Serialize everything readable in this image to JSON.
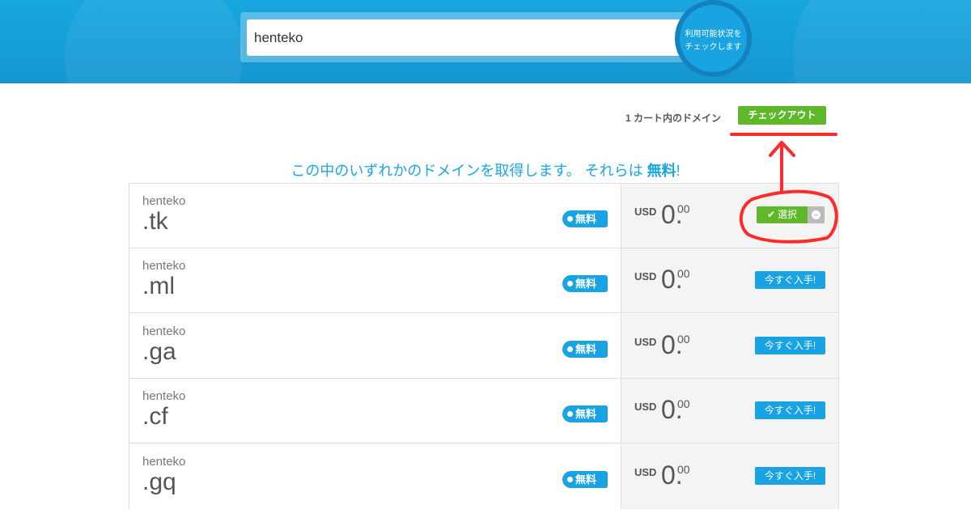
{
  "search": {
    "value": "henteko",
    "button_label": "利用可能状況をチェックします"
  },
  "cart": {
    "text": "1 カート内のドメイン",
    "checkout_label": "チェックアウト"
  },
  "heading": {
    "prefix": "この中のいずれかのドメインを取得します。 それらは ",
    "highlight": "無料",
    "suffix": "!"
  },
  "domains": [
    {
      "name": "henteko",
      "tld": ".tk",
      "badge": "無料",
      "currency": "USD",
      "price_int": "0.",
      "price_dec": "00",
      "action": "選択",
      "selected": true
    },
    {
      "name": "henteko",
      "tld": ".ml",
      "badge": "無料",
      "currency": "USD",
      "price_int": "0.",
      "price_dec": "00",
      "action": "今すぐ入手!",
      "selected": false
    },
    {
      "name": "henteko",
      "tld": ".ga",
      "badge": "無料",
      "currency": "USD",
      "price_int": "0.",
      "price_dec": "00",
      "action": "今すぐ入手!",
      "selected": false
    },
    {
      "name": "henteko",
      "tld": ".cf",
      "badge": "無料",
      "currency": "USD",
      "price_int": "0.",
      "price_dec": "00",
      "action": "今すぐ入手!",
      "selected": false
    },
    {
      "name": "henteko",
      "tld": ".gq",
      "badge": "無料",
      "currency": "USD",
      "price_int": "0.",
      "price_dec": "00",
      "action": "今すぐ入手!",
      "selected": false
    }
  ],
  "icons": {
    "select_check": "check-icon",
    "remove": "minus-circle-icon",
    "badge_dot": "dot-icon"
  },
  "colors": {
    "brand_blue": "#1aa3e3",
    "accent_green": "#5fb829",
    "annotation_red": "#ff2a2a"
  }
}
